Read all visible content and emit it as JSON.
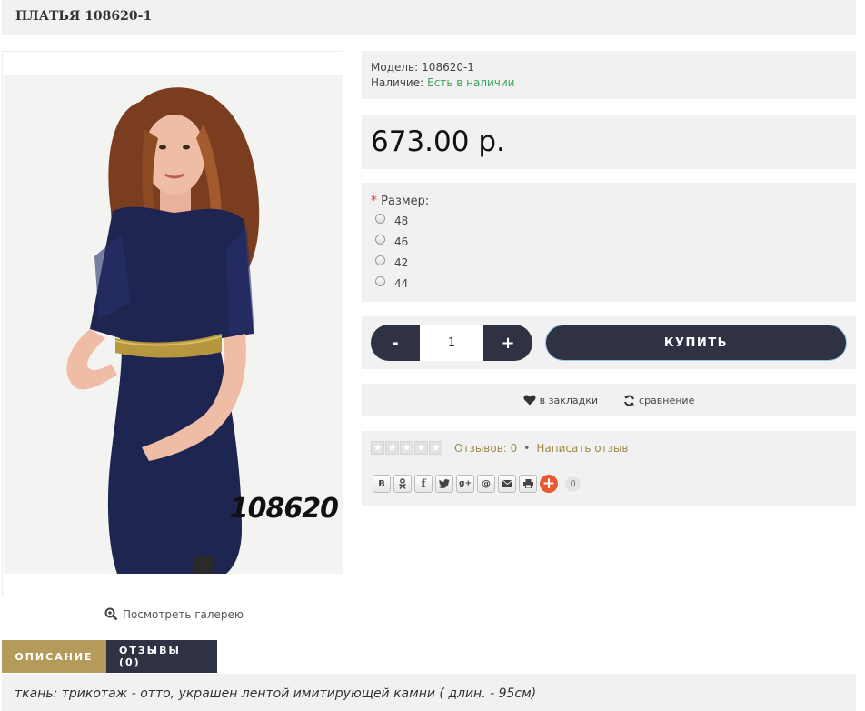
{
  "title": "ПЛАТЬЯ 108620-1",
  "photo": {
    "watermark_text": "108620"
  },
  "gallery_link": "Посмотреть галерею",
  "info": {
    "model_label": "Модель:",
    "model_value": "108620-1",
    "availability_label": "Наличие:",
    "availability_value": "Есть в наличии"
  },
  "price": "673.00 р.",
  "options": {
    "required_mark": "*",
    "title": "Размер:",
    "sizes": [
      "48",
      "46",
      "42",
      "44"
    ]
  },
  "cart": {
    "minus_label": "-",
    "plus_label": "+",
    "quantity": "1",
    "buy_label": "КУПИТЬ"
  },
  "links": {
    "wishlist_label": "в закладки",
    "compare_label": "сравнение"
  },
  "rating": {
    "stars_filled": 0,
    "stars_total": 5,
    "reviews_link": "Отзывов: 0",
    "separator": "•",
    "write_review_link": "Написать отзыв"
  },
  "share": {
    "buttons": [
      "В",
      "ok",
      "f",
      "twitter",
      "g+",
      "@",
      "mail",
      "print"
    ],
    "count": "0"
  },
  "tabs": {
    "description_label": "ОПИСАНИЕ",
    "reviews_label": "ОТЗЫВЫ (0)"
  },
  "description": "ткань: трикотаж - отто, украшен лентой имитирующей камни ( длин. - 95см)",
  "colors": {
    "accent_gold": "#b49b5a",
    "dark_navy": "#2f3242",
    "in_stock_green": "#3aa35a",
    "share_plus": "#e85a33",
    "panel_bg": "#f1f1f1"
  }
}
